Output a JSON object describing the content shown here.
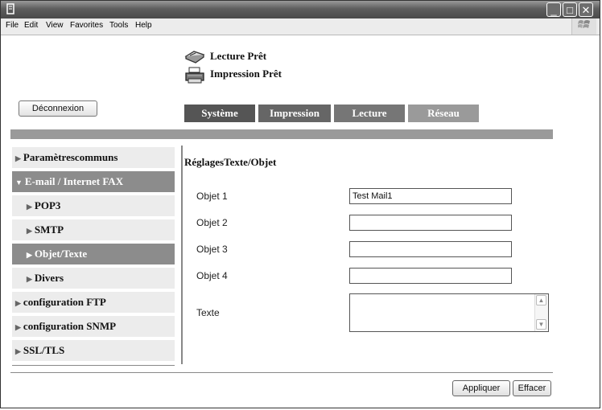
{
  "window": {
    "controls": {
      "minimize": "_",
      "maximize": "□",
      "close": "✕"
    }
  },
  "menubar": {
    "items": [
      "File",
      "Edit",
      "View",
      "Favorites",
      "Tools",
      "Help"
    ]
  },
  "status": {
    "scan": "Lecture Prêt",
    "print": "Impression Prêt"
  },
  "logout_label": "Déconnexion",
  "tabs": [
    {
      "label": "Système",
      "color": "#555555"
    },
    {
      "label": "Impression",
      "color": "#666666"
    },
    {
      "label": "Lecture",
      "color": "#767676"
    },
    {
      "label": "Réseau",
      "color": "#9a9a9a"
    }
  ],
  "sidebar": {
    "items": [
      {
        "label": "Paramètrescommuns",
        "active": false
      },
      {
        "label": "E-mail / Internet FAX",
        "active": true
      },
      {
        "label": "POP3",
        "active": false
      },
      {
        "label": "SMTP",
        "active": false
      },
      {
        "label": "Objet/Texte",
        "active": true
      },
      {
        "label": "Divers",
        "active": false
      },
      {
        "label": "configuration FTP",
        "active": false
      },
      {
        "label": "configuration SNMP",
        "active": false
      },
      {
        "label": "SSL/TLS",
        "active": false
      }
    ]
  },
  "content": {
    "title": "RéglagesTexte/Objet",
    "fields": [
      {
        "label": "Objet 1",
        "value": "Test Mail1"
      },
      {
        "label": "Objet 2",
        "value": ""
      },
      {
        "label": "Objet 3",
        "value": ""
      },
      {
        "label": "Objet 4",
        "value": ""
      }
    ],
    "text_label": "Texte"
  },
  "actions": {
    "apply": "Appliquer",
    "clear": "Effacer"
  },
  "icons": {
    "sidebar_arrow": "▶",
    "sidebar_arrow_open": "▼",
    "scroll_up": "▲",
    "scroll_down": "▼"
  }
}
